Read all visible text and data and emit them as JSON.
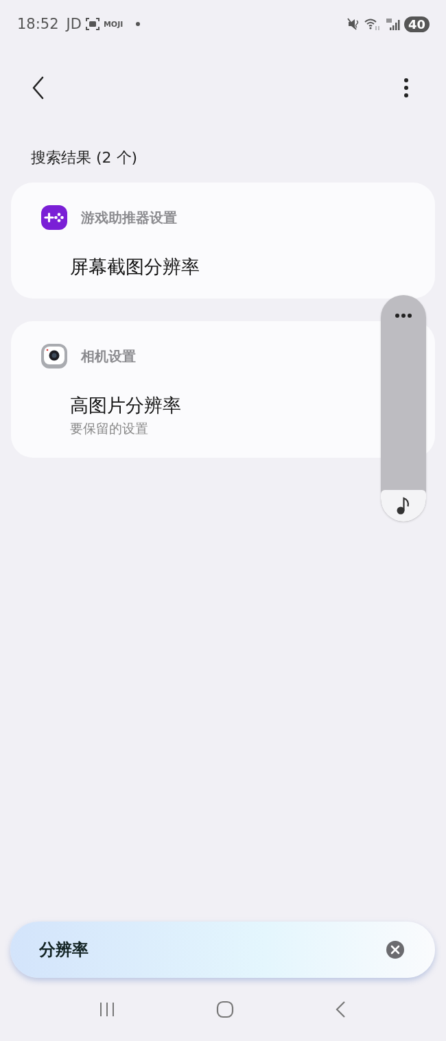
{
  "status_bar": {
    "time": "18:52",
    "app_label": "JD",
    "app_badge": "MOJI",
    "battery": "40"
  },
  "header": {
    "title": "搜索结果 (2 个)"
  },
  "results": [
    {
      "category": "游戏助推器设置",
      "kind": "game",
      "title": "屏幕截图分辨率"
    },
    {
      "category": "相机设置",
      "kind": "camera",
      "title": "高图片分辨率",
      "subtitle": "要保留的设置"
    }
  ],
  "search": {
    "value": "分辨率"
  }
}
